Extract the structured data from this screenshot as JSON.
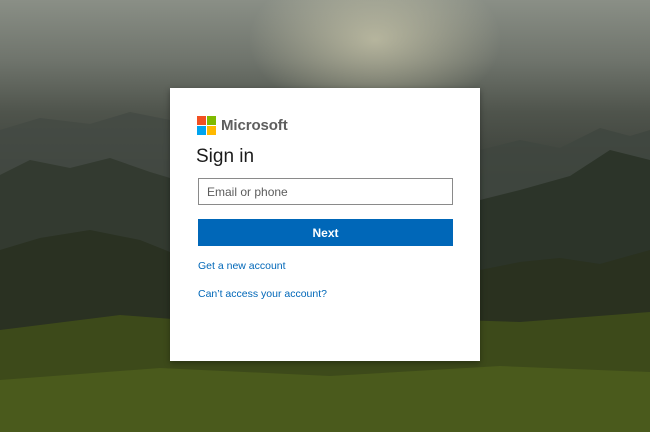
{
  "brand": {
    "name": "Microsoft",
    "logo_colors": [
      "#f25022",
      "#7fba00",
      "#00a4ef",
      "#ffb900"
    ]
  },
  "signin": {
    "title": "Sign in",
    "email_placeholder": "Email or phone",
    "next_label": "Next",
    "new_account_link": "Get a new account",
    "cant_access_link": "Can’t access your account?"
  },
  "colors": {
    "accent": "#0067b8",
    "card_background": "#ffffff"
  },
  "background": {
    "description_icon": "landscape-background"
  }
}
